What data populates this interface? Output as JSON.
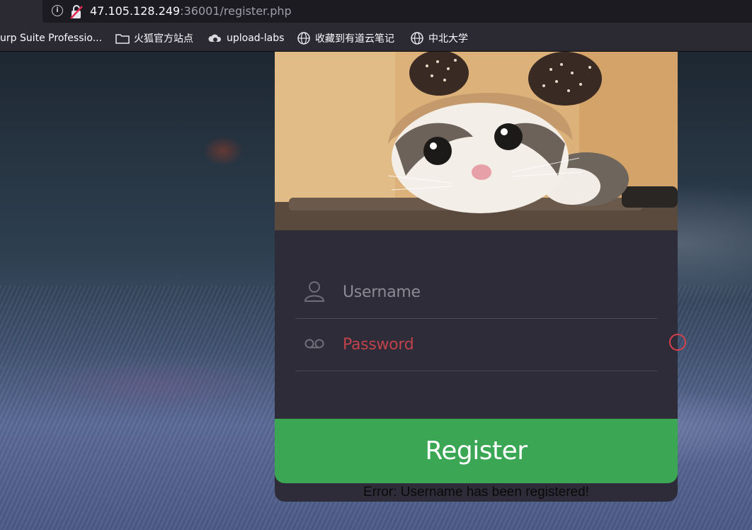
{
  "browser": {
    "url_host": "47.105.128.249",
    "url_path": ":36001/register.php",
    "icons": {
      "info": "info-icon",
      "connection": "insecure-connection-icon"
    }
  },
  "bookmarks": [
    {
      "label": "urp Suite Professio...",
      "icon": "none"
    },
    {
      "label": "火狐官方站点",
      "icon": "folder-icon"
    },
    {
      "label": "upload-labs",
      "icon": "cloud-icon"
    },
    {
      "label": "收藏到有道云笔记",
      "icon": "globe-icon"
    },
    {
      "label": "中北大学",
      "icon": "globe-icon"
    }
  ],
  "form": {
    "username_placeholder": "Username",
    "password_placeholder": "Password",
    "register_label": "Register",
    "error_message": "Error: Username has been registered!"
  },
  "colors": {
    "card_bg": "#2d2c38",
    "register_button": "#3ba754",
    "password_error": "#c0434b"
  }
}
